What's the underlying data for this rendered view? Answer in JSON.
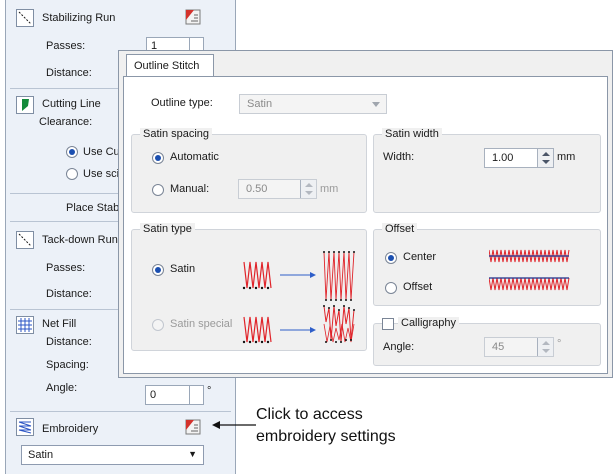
{
  "left_panel": {
    "stabilizing_run": {
      "title": "Stabilizing Run",
      "passes_label": "Passes:",
      "passes_value": "1",
      "distance_label": "Distance:"
    },
    "cutting_line": {
      "title": "Cutting Line",
      "clearance_label": "Clearance:",
      "option_cutwork": "Use CutW",
      "option_scissors": "Use sciss"
    },
    "place_stabilizer": "Place Stabiliz",
    "tackdown_run": {
      "title": "Tack-down Run",
      "passes_label": "Passes:",
      "distance_label": "Distance:"
    },
    "net_fill": {
      "title": "Net Fill",
      "distance_label": "Distance:",
      "spacing_label": "Spacing:",
      "angle_label": "Angle:",
      "angle_value": "0",
      "angle_unit": "°"
    },
    "embroidery": {
      "title": "Embroidery",
      "selected_type": "Satin"
    }
  },
  "dialog": {
    "tab_label": "Outline Stitch",
    "outline_type_label": "Outline type:",
    "outline_type_value": "Satin",
    "satin_spacing": {
      "title": "Satin spacing",
      "automatic_label": "Automatic",
      "manual_label": "Manual:",
      "manual_value": "0.50",
      "unit": "mm"
    },
    "satin_width": {
      "title": "Satin width",
      "width_label": "Width:",
      "width_value": "1.00",
      "unit": "mm"
    },
    "satin_type": {
      "title": "Satin type",
      "satin_label": "Satin",
      "satin_special_label": "Satin special"
    },
    "offset": {
      "title": "Offset",
      "center_label": "Center",
      "offset_label": "Offset"
    },
    "calligraphy": {
      "label": "Calligraphy",
      "angle_label": "Angle:",
      "angle_value": "45",
      "angle_unit": "°"
    }
  },
  "callout": {
    "line1": "Click to access",
    "line2": "embroidery settings"
  },
  "colors": {
    "panel_bg": "#ecf1f8",
    "accent_blue": "#1b4fb0",
    "stitch_red": "#e0242a",
    "arrow_blue": "#2e5ec9"
  }
}
